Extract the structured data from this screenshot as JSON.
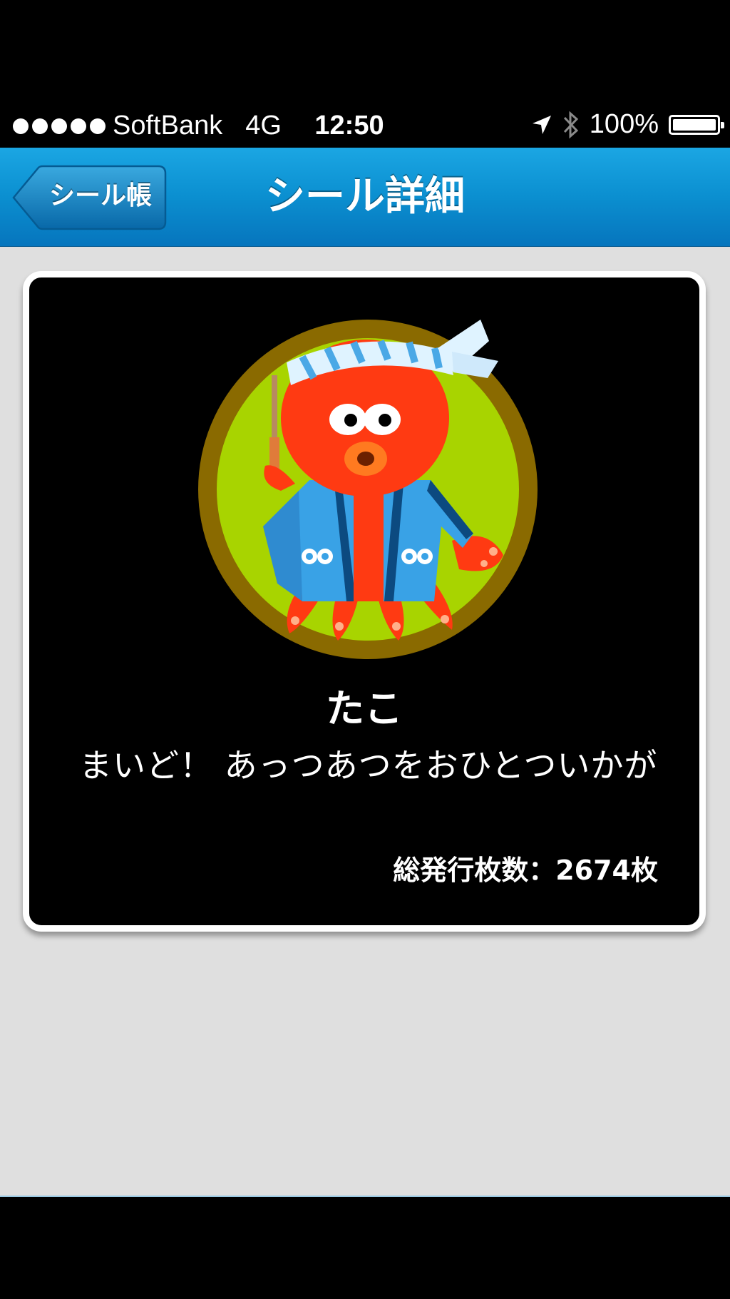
{
  "status_bar": {
    "carrier": "SoftBank",
    "network": "4G",
    "time": "12:50",
    "battery": "100%",
    "battery_level": 1.0,
    "icons": [
      "signal-dots-icon",
      "location-arrow-icon",
      "bluetooth-icon",
      "battery-icon"
    ]
  },
  "nav": {
    "back_label": "シール帳",
    "title": "シール詳細"
  },
  "sticker": {
    "name": "たこ",
    "message": "まいど！ あっつあつをおひとついかが",
    "issued_label": "総発行枚数：2674枚",
    "image": "octopus-festival-sticker"
  },
  "colors": {
    "nav_blue": "#0b8fd0",
    "background": "#dfdfdf",
    "card": "#000000",
    "octopus_red": "#ff3a12",
    "sticker_green": "#a8d400",
    "sticker_border": "#8a6a00",
    "happi_blue": "#39a2e6"
  }
}
